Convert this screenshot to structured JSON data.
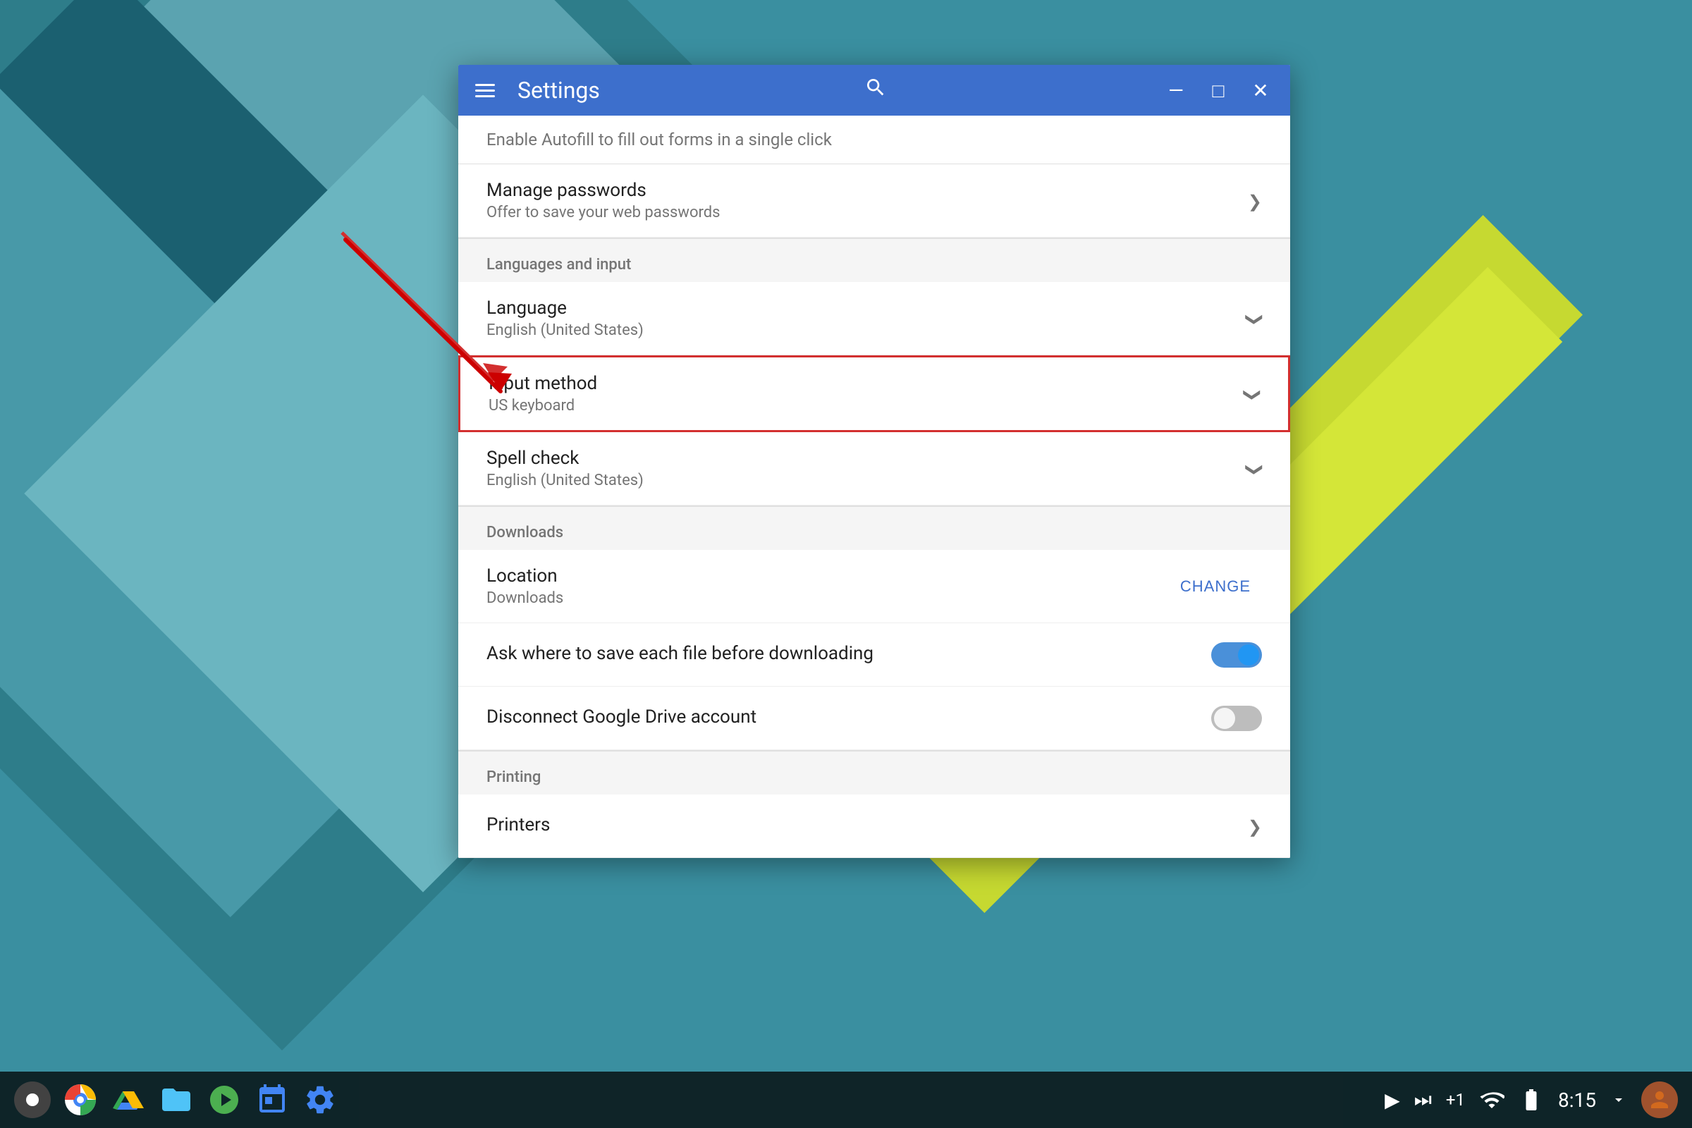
{
  "desktop": {
    "taskbar": {
      "time": "8:15",
      "icons": [
        {
          "name": "record",
          "label": "Record"
        },
        {
          "name": "chrome",
          "label": "Chrome"
        },
        {
          "name": "drive",
          "label": "Google Drive"
        },
        {
          "name": "files",
          "label": "Files"
        },
        {
          "name": "hangouts",
          "label": "Hangouts"
        },
        {
          "name": "calendar",
          "label": "Calendar"
        },
        {
          "name": "settings",
          "label": "Settings"
        }
      ],
      "right_items": [
        {
          "name": "play",
          "label": "▶"
        },
        {
          "name": "forward",
          "label": "⏭"
        },
        {
          "name": "plus-one",
          "label": "+1"
        },
        {
          "name": "wifi",
          "label": "wifi"
        },
        {
          "name": "time",
          "label": "8:15"
        }
      ]
    }
  },
  "window": {
    "title": "Settings",
    "controls": {
      "minimize": "—",
      "maximize": "□",
      "close": "✕"
    }
  },
  "settings": {
    "autofill_hint": "Enable Autofill to fill out forms in a single click",
    "sections": {
      "manage_passwords": {
        "title": "Manage passwords",
        "subtitle": "Offer to save your web passwords"
      },
      "languages_input_header": "Languages and input",
      "language": {
        "title": "Language",
        "subtitle": "English (United States)"
      },
      "input_method": {
        "title": "Input method",
        "subtitle": "US keyboard"
      },
      "spell_check": {
        "title": "Spell check",
        "subtitle": "English (United States)"
      },
      "downloads_header": "Downloads",
      "location": {
        "title": "Location",
        "subtitle": "Downloads",
        "button": "CHANGE"
      },
      "ask_where": {
        "title": "Ask where to save each file before downloading",
        "toggle_state": "on"
      },
      "disconnect_drive": {
        "title": "Disconnect Google Drive account",
        "toggle_state": "off"
      },
      "printing_header": "Printing",
      "printers": {
        "title": "Printers"
      }
    }
  }
}
